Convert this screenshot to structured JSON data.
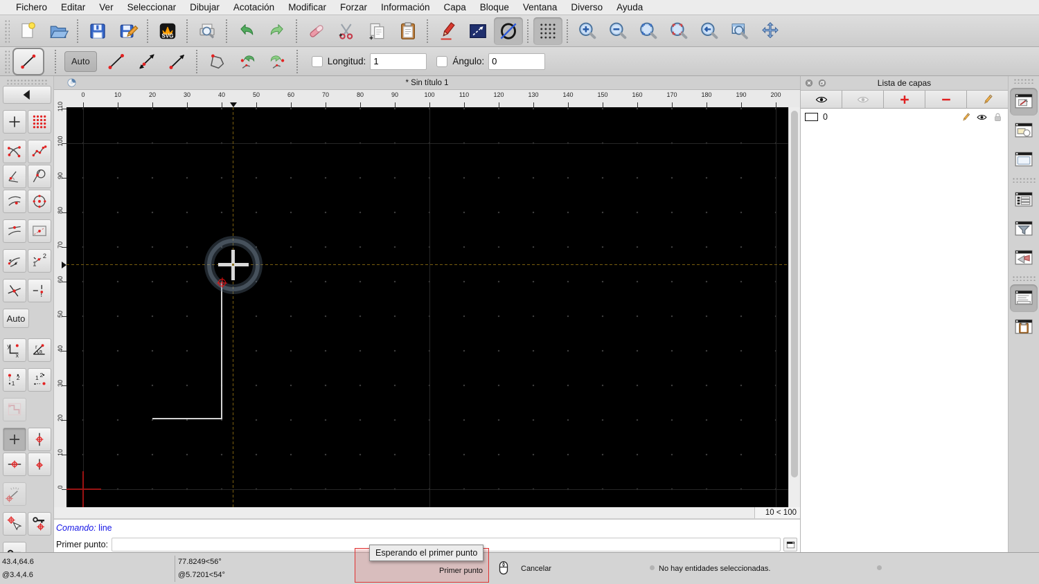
{
  "app": {
    "tab_title": "* Sin título 1"
  },
  "menu": {
    "items": [
      "Fichero",
      "Editar",
      "Ver",
      "Seleccionar",
      "Dibujar",
      "Acotación",
      "Modificar",
      "Forzar",
      "Información",
      "Capa",
      "Bloque",
      "Ventana",
      "Diverso",
      "Ayuda"
    ]
  },
  "toolbar_main": {
    "groups": [
      [
        {
          "name": "new-file-button",
          "icon": "new-file-icon"
        },
        {
          "name": "open-file-button",
          "icon": "open-file-icon"
        }
      ],
      [
        {
          "name": "save-button",
          "icon": "save-icon"
        },
        {
          "name": "save-as-button",
          "icon": "save-as-icon"
        }
      ],
      [
        {
          "name": "svg-export-button",
          "icon": "svg-export-icon"
        }
      ],
      [
        {
          "name": "print-preview-button",
          "icon": "print-preview-icon"
        }
      ],
      [
        {
          "name": "undo-button",
          "icon": "undo-icon"
        },
        {
          "name": "redo-button",
          "icon": "redo-icon"
        }
      ],
      [
        {
          "name": "delete-button",
          "icon": "eraser-icon"
        },
        {
          "name": "cut-button",
          "icon": "cut-icon"
        },
        {
          "name": "copy-button",
          "icon": "copy-icon"
        },
        {
          "name": "paste-button",
          "icon": "paste-icon"
        }
      ],
      [
        {
          "name": "pen-attributes-button",
          "icon": "pen-icon"
        },
        {
          "name": "line-attributes-button",
          "icon": "line-attributes-icon"
        },
        {
          "name": "draft-mode-button",
          "icon": "draft-mode-icon",
          "active": true
        }
      ],
      [
        {
          "name": "grid-toggle-button",
          "icon": "grid-icon",
          "active": true
        }
      ],
      [
        {
          "name": "zoom-in-button",
          "icon": "zoom-in-icon"
        },
        {
          "name": "zoom-out-button",
          "icon": "zoom-out-icon"
        },
        {
          "name": "zoom-auto-button",
          "icon": "zoom-auto-icon"
        },
        {
          "name": "zoom-previous-button",
          "icon": "zoom-previous-icon"
        },
        {
          "name": "zoom-back-button",
          "icon": "zoom-back-icon"
        },
        {
          "name": "zoom-window-button",
          "icon": "zoom-window-icon"
        },
        {
          "name": "pan-button",
          "icon": "pan-icon"
        }
      ]
    ]
  },
  "toolbar_options": {
    "current_tool_icon": "line-2p-icon",
    "auto_label": "Auto",
    "variant_buttons": [
      {
        "name": "line-two-points-button",
        "icon": "line-2p-icon"
      },
      {
        "name": "line-both-directions-button",
        "icon": "line-2a-icon"
      },
      {
        "name": "line-direction-button",
        "icon": "line-angle-icon"
      }
    ],
    "shape_buttons": [
      {
        "name": "polyline-button",
        "icon": "polyline-icon"
      },
      {
        "name": "undo-segment-button",
        "icon": "segment-undo-icon"
      },
      {
        "name": "redo-segment-button",
        "icon": "segment-redo-icon"
      }
    ],
    "length_label": "Longitud:",
    "length_value": "1",
    "angle_label": "Ángulo:",
    "angle_value": "0"
  },
  "sidebar": {
    "groups": [
      {
        "items": [
          {
            "name": "snap-back-button",
            "icon": "back-icon",
            "wide": true
          }
        ]
      },
      {
        "items": [
          {
            "name": "snap-free-button",
            "icon": "snap-free-icon"
          },
          {
            "name": "snap-grid-button",
            "icon": "snap-grid-icon"
          }
        ]
      },
      {
        "items": [
          {
            "name": "snap-endpoint-button",
            "icon": "snap-endpoint-icon"
          },
          {
            "name": "snap-on-entity-button",
            "icon": "snap-entity-icon"
          },
          {
            "name": "snap-perpendicular-button",
            "icon": "snap-perpendicular-icon"
          },
          {
            "name": "snap-tangent-button",
            "icon": "snap-tangent-icon"
          },
          {
            "name": "snap-nearest-button",
            "icon": "snap-nearest-icon"
          },
          {
            "name": "snap-center-button",
            "icon": "snap-center-icon"
          }
        ]
      },
      {
        "items": [
          {
            "name": "snap-middle-button",
            "icon": "snap-middle-icon"
          },
          {
            "name": "snap-distance-button",
            "icon": "snap-distance-icon"
          }
        ]
      },
      {
        "items": [
          {
            "name": "snap-directional-button",
            "icon": "snap-directional-icon"
          },
          {
            "name": "snap-reference-button",
            "icon": "snap-reference-icon"
          }
        ]
      },
      {
        "items": [
          {
            "name": "snap-intersection-button",
            "icon": "snap-intersection-icon"
          },
          {
            "name": "snap-intersection-manual-button",
            "icon": "snap-intersection-manual-icon"
          }
        ]
      },
      {
        "items": [
          {
            "name": "snap-auto-button",
            "label": "Auto"
          },
          null
        ]
      },
      {
        "items": [
          {
            "name": "coord-cartesian-button",
            "icon": "coord-cartesian-icon"
          },
          {
            "name": "coord-polar-button",
            "icon": "coord-polar-icon"
          }
        ]
      },
      {
        "items": [
          {
            "name": "reference-point-1-button",
            "icon": "ref-point1-icon"
          },
          {
            "name": "reference-point-2-button",
            "icon": "ref-point2-icon"
          }
        ]
      },
      {
        "items": [
          {
            "name": "restrict-orthogonal-button",
            "icon": "restrict-ortho-icon",
            "disabled": true
          },
          null
        ]
      },
      {
        "items": [
          {
            "name": "restrict-nothing-button",
            "icon": "restrict-nothing-icon",
            "active": true
          },
          {
            "name": "restrict-vertical-button",
            "icon": "restrict-vertical-icon"
          },
          {
            "name": "restrict-horizontal-button",
            "icon": "restrict-horizontal-icon"
          },
          {
            "name": "restrict-vertical-short-button",
            "icon": "restrict-vertical-short-icon"
          }
        ]
      },
      {
        "items": [
          {
            "name": "angle-gauge-button",
            "icon": "angle-gauge-icon",
            "disabled": true
          },
          null
        ]
      },
      {
        "items": [
          {
            "name": "set-relative-zero-button",
            "icon": "set-relative-zero-icon"
          },
          {
            "name": "lock-relative-zero-button",
            "icon": "lock-relative-zero-icon"
          }
        ]
      },
      {
        "items": [
          {
            "name": "relative-zero-button",
            "icon": "relative-zero-icon"
          },
          null
        ]
      }
    ]
  },
  "ruler": {
    "top_labels": [
      "0",
      "10",
      "20",
      "30",
      "40",
      "50",
      "60",
      "70",
      "80",
      "90",
      "100",
      "110",
      "120",
      "130",
      "140",
      "150",
      "160",
      "170",
      "180",
      "190",
      "200"
    ],
    "left_labels": [
      "110",
      "100",
      "90",
      "80",
      "70",
      "60",
      "50",
      "40",
      "30",
      "20",
      "10",
      "0"
    ]
  },
  "canvas": {
    "grid_status": "10 < 100"
  },
  "layer_panel": {
    "title": "Lista de capas",
    "toolbar": [
      {
        "name": "show-all-layers-button",
        "icon": "eye-icon"
      },
      {
        "name": "hide-all-layers-button",
        "icon": "eye-gray-icon"
      },
      {
        "name": "add-layer-button",
        "icon": "plus-icon"
      },
      {
        "name": "remove-layer-button",
        "icon": "minus-icon"
      },
      {
        "name": "edit-layer-button",
        "icon": "pencil-icon"
      }
    ],
    "layers": [
      {
        "name": "0"
      }
    ]
  },
  "dock_right": {
    "buttons": [
      {
        "name": "layer-list-panel-button",
        "icon": "win-pen-icon",
        "active": true
      },
      {
        "name": "block-list-panel-button",
        "icon": "win-shapes-icon"
      },
      {
        "name": "library-panel-button",
        "icon": "win-blank-icon"
      },
      {
        "sep": true
      },
      {
        "name": "entity-list-panel-button",
        "icon": "win-list-icon"
      },
      {
        "name": "filter-panel-button",
        "icon": "win-funnel-icon"
      },
      {
        "name": "notification-panel-button",
        "icon": "win-horn-icon"
      },
      {
        "sep": true
      },
      {
        "name": "command-panel-button",
        "icon": "win-command-icon",
        "active": true
      },
      {
        "name": "clipboard-panel-button",
        "icon": "win-clipboard-icon"
      }
    ]
  },
  "command": {
    "history_label": "Comando:",
    "history_value": "line",
    "prompt_label": "Primer punto:",
    "prompt_value": ""
  },
  "tooltip": {
    "text": "Esperando el primer punto"
  },
  "statusbar": {
    "abs_coord": "43.4,64.6",
    "rel_coord": "@3.4,4.6",
    "abs_polar": "77.8249<56°",
    "rel_polar": "@5.7201<54°",
    "left_hint": "Primer punto",
    "right_hint": "Cancelar",
    "selection_status": "No hay entidades seleccionadas."
  },
  "colors": {
    "canvas_bg": "#000000",
    "crosshair": "#7c6010",
    "snap_ring": "#8094a8",
    "entity": "#d4d4d4",
    "snap_point": "#e01010",
    "origin": "#9b1313",
    "hint_border": "#e03030",
    "command_text": "#1414e6"
  }
}
